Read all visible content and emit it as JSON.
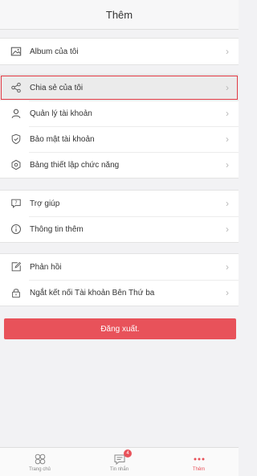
{
  "header": {
    "title": "Thêm"
  },
  "groups": [
    {
      "items": [
        {
          "label": "Album của tôi",
          "icon": "image-icon"
        }
      ]
    },
    {
      "items": [
        {
          "label": "Chia sẻ của tôi",
          "icon": "share-icon",
          "highlighted": true
        },
        {
          "label": "Quản lý tài khoản",
          "icon": "user-icon"
        },
        {
          "label": "Bảo mật tài khoản",
          "icon": "shield-check-icon"
        },
        {
          "label": "Bảng thiết lập chức năng",
          "icon": "settings-hex-icon"
        }
      ]
    },
    {
      "items": [
        {
          "label": "Trợ giúp",
          "icon": "help-chat-icon"
        },
        {
          "label": "Thông tin thêm",
          "icon": "info-icon"
        }
      ]
    },
    {
      "items": [
        {
          "label": "Phản hồi",
          "icon": "feedback-edit-icon"
        },
        {
          "label": "Ngắt kết nối Tài khoản Bên Thứ ba",
          "icon": "lock-icon"
        }
      ]
    }
  ],
  "logout": {
    "label": "Đăng xuất."
  },
  "tabbar": {
    "tabs": [
      {
        "label": "Trang chủ",
        "icon": "home-icon"
      },
      {
        "label": "Tin nhắn",
        "icon": "message-icon",
        "badge": "4"
      },
      {
        "label": "Thêm",
        "icon": "more-dots-icon",
        "active": true
      }
    ]
  },
  "colors": {
    "accent": "#e8525a",
    "highlight_border": "#e23a45"
  }
}
